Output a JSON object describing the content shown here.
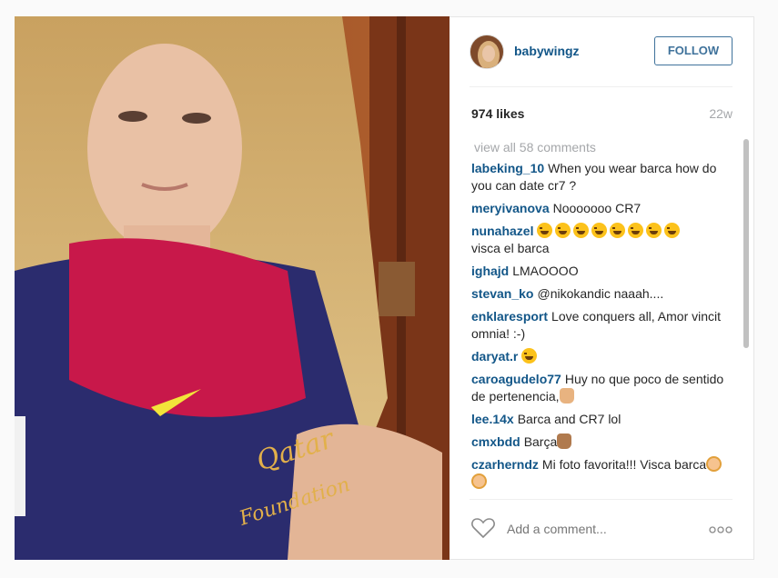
{
  "post": {
    "username": "babywingz",
    "follow_label": "FOLLOW",
    "likes": "974 likes",
    "age": "22w",
    "view_all": "view all 58 comments",
    "add_comment_placeholder": "Add a comment...",
    "more_label": "ooo"
  },
  "comments": [
    {
      "user": "labeking_10",
      "text": "When you wear barca how do you can date cr7 ?"
    },
    {
      "user": "meryivanova",
      "text": "Nooooooo CR7"
    },
    {
      "user": "nunahazel",
      "text": "visca el barca",
      "emoji": "laughing-tears",
      "emoji_count": 8
    },
    {
      "user": "ighajd",
      "text": "LMAOOOO"
    },
    {
      "user": "stevan_ko",
      "text": "@nikokandic naaah...."
    },
    {
      "user": "enklaresport",
      "text": "Love conquers all, Amor vincit omnia! :-)"
    },
    {
      "user": "daryat.r",
      "text": "",
      "emoji": "laughing-tears",
      "emoji_count": 1
    },
    {
      "user": "caroagudelo77",
      "text": "Huy no que poco de sentido de pertenencia,",
      "emoji": "thumbs-down",
      "emoji_count": 1
    },
    {
      "user": "lee.14x",
      "text": "Barca and CR7 lol"
    },
    {
      "user": "cmxbdd",
      "text": "Barça",
      "emoji": "thumbs-up",
      "emoji_count": 1
    },
    {
      "user": "czarherndz",
      "text": "Mi foto favorita!!! Visca barca",
      "emoji": "girl",
      "emoji_count": 2
    }
  ],
  "photo": {
    "jersey_text_1": "Qatar",
    "jersey_text_2": "Foundation"
  },
  "colors": {
    "link": "#125688",
    "follow": "#3f729b",
    "muted": "#a5a7aa"
  }
}
